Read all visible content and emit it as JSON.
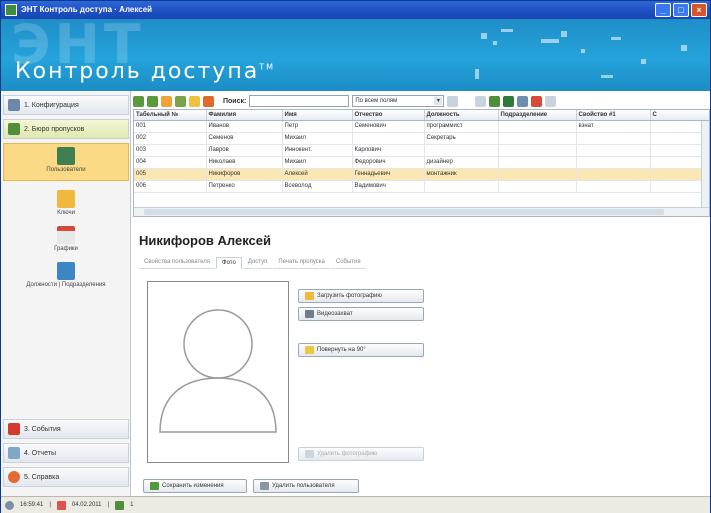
{
  "window": {
    "title": "ЭНТ Контроль доступа · Алексей"
  },
  "banner": {
    "ghost_text": "ЭНТ",
    "logo_text": "Контроль доступа",
    "logo_tm": "TM"
  },
  "sidebar": {
    "sections": [
      {
        "label": "1. Конфигурация"
      },
      {
        "label": "2. Бюро пропусков"
      },
      {
        "label": "3. События"
      },
      {
        "label": "4. Отчеты"
      },
      {
        "label": "5. Справка"
      }
    ],
    "subitems": [
      {
        "label": "Пользователи"
      },
      {
        "label": "Ключи"
      },
      {
        "label": "Графики"
      },
      {
        "label": "Должности | Подразделения"
      }
    ]
  },
  "toolbar": {
    "search_label": "Поиск:",
    "search_value": "",
    "filter_value": "По всем полям"
  },
  "grid": {
    "columns": [
      "Табельный №",
      "Фамилия",
      "Имя",
      "Отчество",
      "Должность",
      "Подразделение",
      "Свойство #1",
      "С"
    ],
    "rows": [
      [
        "001",
        "Иванов",
        "Петр",
        "Семенович",
        "программист",
        "",
        "взнат",
        ""
      ],
      [
        "002",
        "Семенов",
        "Михаил",
        "",
        "Секретарь",
        "",
        "",
        ""
      ],
      [
        "003",
        "Лавров",
        "Иннокент.",
        "Карлович",
        "",
        "",
        "",
        ""
      ],
      [
        "004",
        "Николаев",
        "Михаил",
        "Федорович",
        "дизайнер",
        "",
        "",
        ""
      ],
      [
        "005",
        "Никифоров",
        "Алексей",
        "Геннадьевич",
        "монтажник",
        "",
        "",
        ""
      ],
      [
        "006",
        "Петренко",
        "Всеволод",
        "Вадимович",
        "",
        "",
        "",
        ""
      ]
    ]
  },
  "detail": {
    "name": "Никифоров Алексей",
    "tabs": [
      "Свойства пользователя",
      "Фото",
      "Доступ",
      "Печать пропуска",
      "События"
    ],
    "buttons": {
      "upload_photo": "Загрузить фотографию",
      "camera": "Видеозахват",
      "rotate": "Повернуть на 90°",
      "delete_photo": "Удалить фотографию",
      "save_changes": "Сохранить изменения",
      "delete_user": "Удалить пользователя"
    }
  },
  "statusbar": {
    "time": "16:59:41",
    "date": "04.02.2011",
    "users_count": "1"
  }
}
